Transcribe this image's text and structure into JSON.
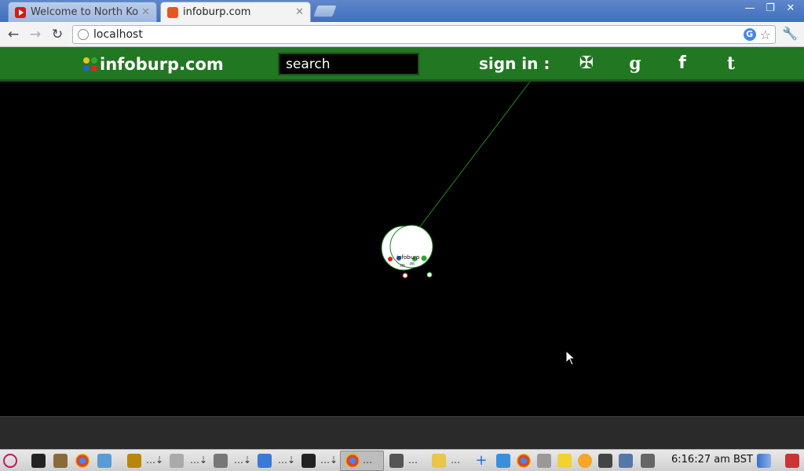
{
  "browser": {
    "tabs": [
      {
        "title": "Welcome to North Korea",
        "favicon": "youtube-icon",
        "active": false
      },
      {
        "title": "infoburp.com",
        "favicon": "infoburp-icon",
        "active": true
      }
    ],
    "url": "localhost",
    "window_controls": [
      "minimize",
      "restore",
      "close"
    ]
  },
  "site": {
    "logo_text": "infoburp.com",
    "logo_dot_colors": [
      "#e8c21e",
      "#2fa72f",
      "#2d5fc9",
      "#d9262b"
    ],
    "search_placeholder": "search",
    "signin_label": "sign in :",
    "social": [
      {
        "name": "openid",
        "glyph": "✠"
      },
      {
        "name": "google",
        "glyph": "g"
      },
      {
        "name": "facebook",
        "glyph": "f"
      },
      {
        "name": "tumblr",
        "glyph": "t"
      }
    ],
    "header_color": "#227722"
  },
  "graph": {
    "link_color": "#1e8a1e",
    "node_label": "infoburp"
  },
  "taskbar": {
    "clock": "6:16:27 am BST"
  }
}
